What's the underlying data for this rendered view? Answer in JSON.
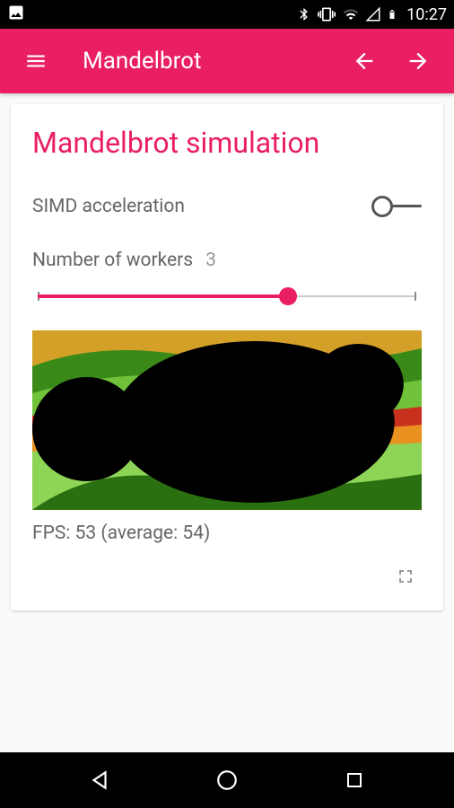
{
  "status": {
    "time": "10:27"
  },
  "appbar": {
    "title": "Mandelbrot"
  },
  "card": {
    "title": "Mandelbrot simulation",
    "simd_label": "SIMD acceleration",
    "workers_label": "Number of workers",
    "workers_value": "3",
    "fps_text": "FPS: 53 (average: 54)"
  },
  "colors": {
    "accent": "#e91e63"
  }
}
